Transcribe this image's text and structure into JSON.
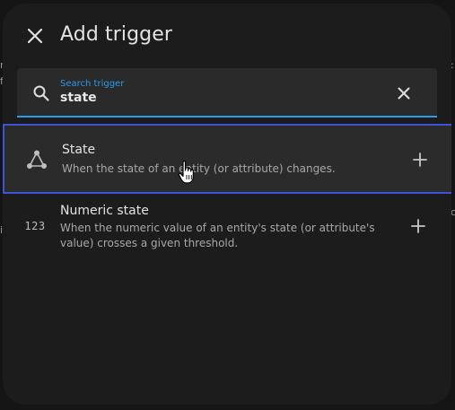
{
  "dialog": {
    "title": "Add trigger",
    "close_icon": "close-icon"
  },
  "search": {
    "label": "Search trigger",
    "value": "state",
    "icon": "search-icon",
    "clear_icon": "close-icon"
  },
  "items": [
    {
      "title": "State",
      "description": "When the state of an entity (or attribute) changes.",
      "icon": "state-graph-icon",
      "add_icon": "plus-icon",
      "selected": true
    },
    {
      "title": "Numeric state",
      "description": "When the numeric value of an entity's state (or attribute's value) crosses a given threshold.",
      "icon_text": "123",
      "add_icon": "plus-icon",
      "selected": false
    }
  ],
  "colors": {
    "accent": "#2e9ae8",
    "selection_border": "#3c55d8",
    "dialog_bg": "#1c1c1c"
  }
}
